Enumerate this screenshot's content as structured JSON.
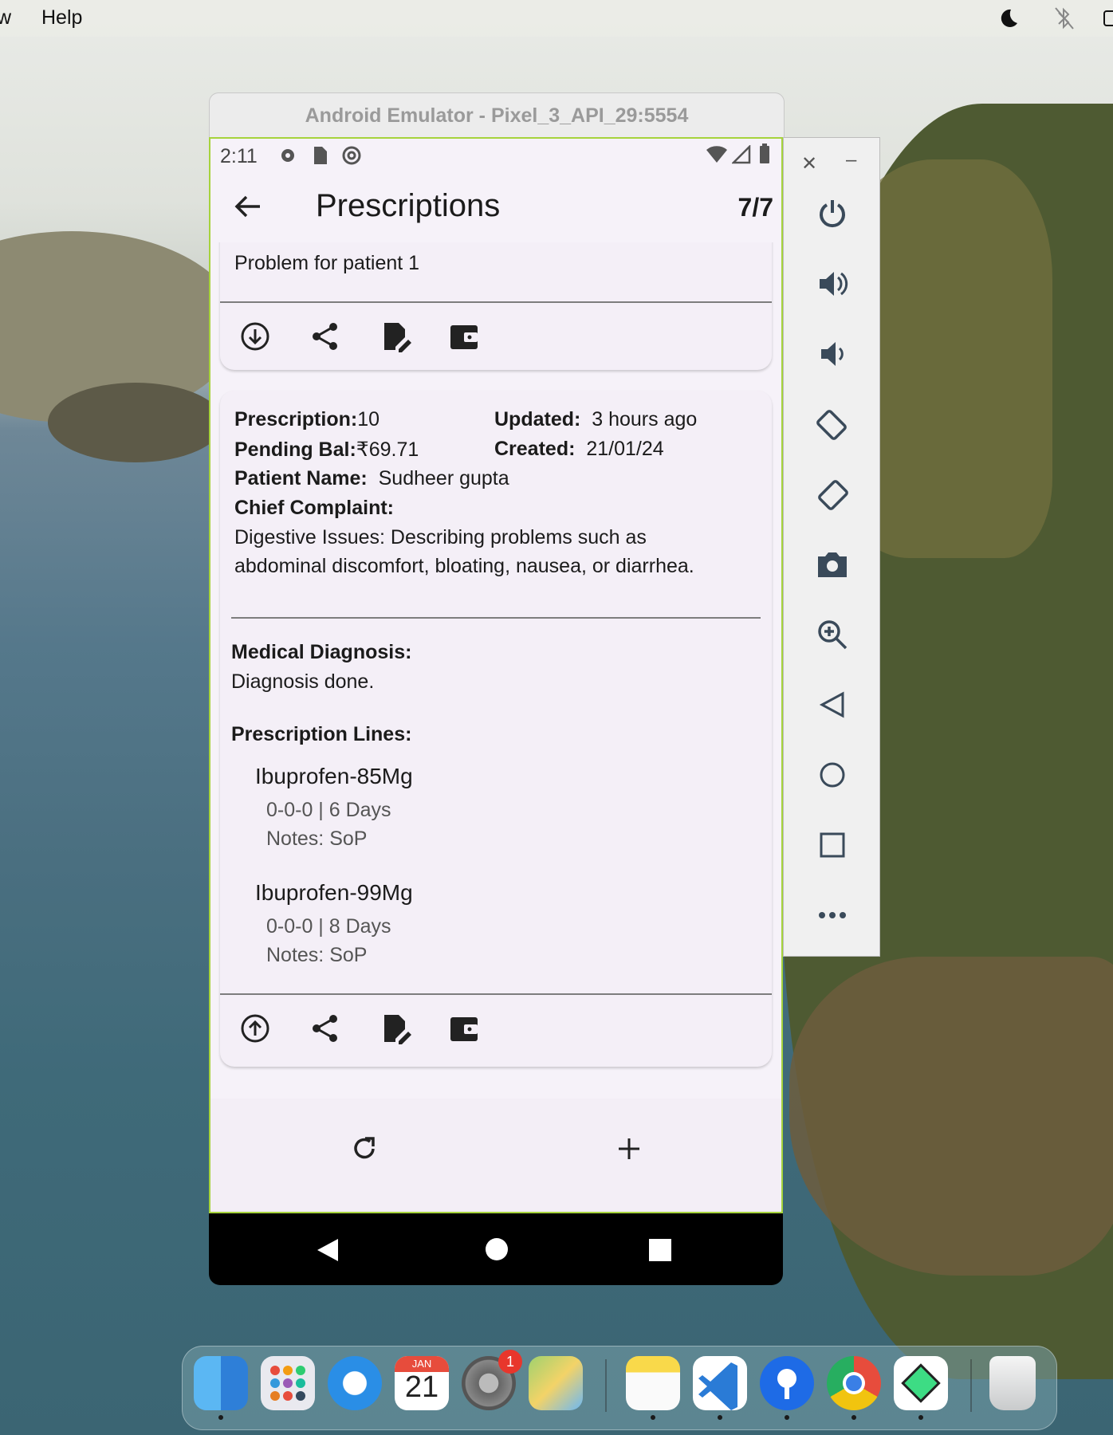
{
  "menubar": {
    "partial_left": "w",
    "help": "Help"
  },
  "window": {
    "title": "Android Emulator - Pixel_3_API_29:5554"
  },
  "status": {
    "time": "2:11"
  },
  "appbar": {
    "title": "Prescriptions",
    "counter": "7/7"
  },
  "card1": {
    "problem_text": "Problem for patient 1"
  },
  "card2": {
    "prescription_label": "Prescription:",
    "prescription_value": "10",
    "updated_label": "Updated:",
    "updated_value": "3 hours ago",
    "pending_label": "Pending Bal:",
    "pending_value": "₹69.71",
    "created_label": "Created:",
    "created_value": "21/01/24",
    "patient_label": "Patient Name:",
    "patient_value": "Sudheer gupta",
    "complaint_label": "Chief Complaint:",
    "complaint_line1": "Digestive Issues: Describing problems such as",
    "complaint_line2": "abdominal discomfort, bloating, nausea, or diarrhea.",
    "diagnosis_label": "Medical Diagnosis:",
    "diagnosis_value": "Diagnosis done.",
    "lines_label": "Prescription Lines:",
    "lines": [
      {
        "name": "Ibuprofen-85Mg",
        "dosage": "0-0-0 | 6 Days",
        "notes": "Notes: SoP"
      },
      {
        "name": "Ibuprofen-99Mg",
        "dosage": "0-0-0 | 8 Days",
        "notes": "Notes: SoP"
      }
    ]
  },
  "dock": {
    "calendar_month": "JAN",
    "calendar_day": "21",
    "settings_badge": "1"
  },
  "colors": {
    "accent_border": "#a6d33c",
    "app_bg": "#f6f2f9",
    "card_bg": "#f4eff7"
  }
}
